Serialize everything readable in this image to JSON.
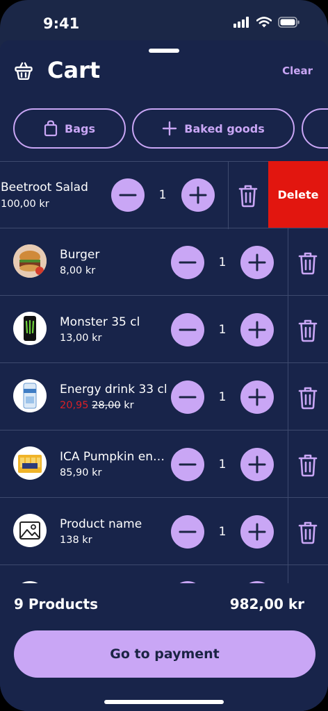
{
  "status": {
    "time": "9:41"
  },
  "header": {
    "title": "Cart",
    "clear_label": "Clear"
  },
  "chips": [
    {
      "label": "Bags",
      "icon": "shopping-bag-icon"
    },
    {
      "label": "Baked goods",
      "icon": "plus-icon"
    }
  ],
  "swiped_item": {
    "name": "Beetroot Salad",
    "price": "100,00 kr",
    "qty": "1",
    "delete_label": "Delete"
  },
  "items": [
    {
      "name": "Burger",
      "price": "8,00 kr",
      "qty": "1",
      "image": "burger-image"
    },
    {
      "name": "Monster 35 cl",
      "price": "13,00 kr",
      "qty": "1",
      "image": "monster-can-image"
    },
    {
      "name": "Energy drink 33 cl",
      "sale_price": "20,95",
      "old_price": "28,00",
      "currency": "kr",
      "qty": "1",
      "image": "energy-drink-can-image"
    },
    {
      "name": "ICA Pumpkin energy",
      "price": "85,90 kr",
      "qty": "1",
      "image": "pumpkin-pack-image"
    },
    {
      "name": "Product name",
      "price": "138 kr",
      "qty": "1",
      "image": "placeholder-image-icon"
    }
  ],
  "footer": {
    "count_label": "9 Products",
    "total": "982,00 kr",
    "pay_label": "Go to payment"
  },
  "colors": {
    "background": "#18244a",
    "accent": "#c9a6f5",
    "danger": "#e2160f",
    "sale": "#d92027"
  }
}
